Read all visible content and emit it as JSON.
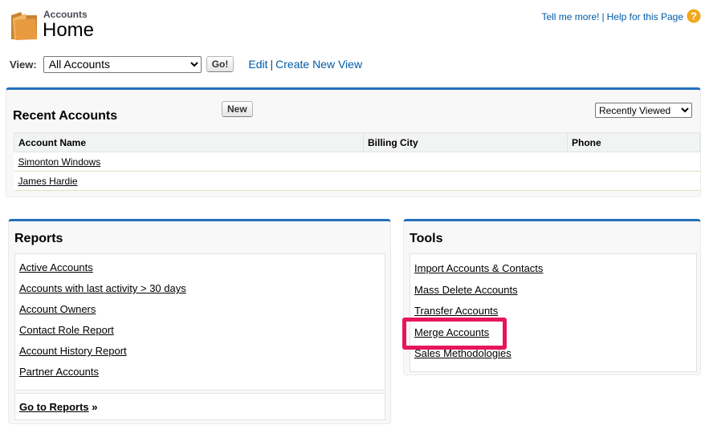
{
  "header": {
    "object_type": "Accounts",
    "page_title": "Home",
    "tell_me_more": "Tell me more!",
    "help_separator": "|",
    "help_page": "Help for this Page",
    "icon": "folder-icon",
    "help_icon": "question-icon",
    "help_icon_glyph": "?"
  },
  "view": {
    "label": "View:",
    "selected": "All Accounts",
    "go_label": "Go!",
    "edit_label": "Edit",
    "separator": "|",
    "create_label": "Create New View"
  },
  "recent": {
    "title": "Recent Accounts",
    "new_label": "New",
    "filter_selected": "Recently Viewed",
    "columns": [
      "Account Name",
      "Billing City",
      "Phone"
    ],
    "rows": [
      {
        "name": "Simonton Windows",
        "city": "",
        "phone": ""
      },
      {
        "name": "James Hardie",
        "city": "",
        "phone": ""
      }
    ]
  },
  "reports": {
    "title": "Reports",
    "items": [
      "Active Accounts",
      "Accounts with last activity > 30 days",
      "Account Owners",
      "Contact Role Report",
      "Account History Report",
      "Partner Accounts"
    ],
    "goto_label": "Go to Reports",
    "goto_suffix": "»"
  },
  "tools": {
    "title": "Tools",
    "items": [
      "Import Accounts & Contacts",
      "Mass Delete Accounts",
      "Transfer Accounts",
      "Merge Accounts",
      "Sales Methodologies"
    ],
    "highlighted_item": "Merge Accounts"
  },
  "colors": {
    "accent_blue": "#236fbd",
    "link_blue": "#015ba7",
    "highlight": "#e6155e",
    "folder": "#e8a04a"
  }
}
